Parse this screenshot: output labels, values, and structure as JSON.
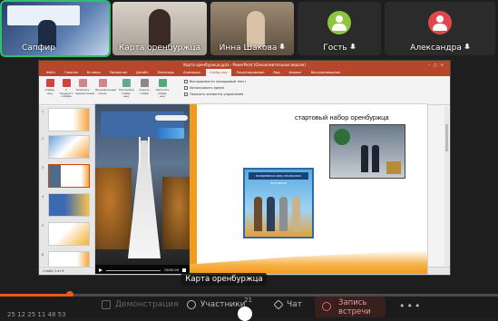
{
  "participants": [
    {
      "name": "Сапфир",
      "active": true
    },
    {
      "name": "Карта оренбуржца",
      "active": false
    },
    {
      "name": "Инна Шакова",
      "active": false
    },
    {
      "name": "Гость",
      "active": false
    },
    {
      "name": "Александра",
      "active": false
    }
  ],
  "colors": {
    "active_border": "#2fbf71",
    "guest_avatar": "#8cc63f",
    "alex_avatar": "#e0474c",
    "brand_orange": "#e45b1a",
    "ppt_red": "#b7472a"
  },
  "presentation": {
    "window_title": "Карта оренбуржца.pptx - PowerPoint (Ознакомительная версия)",
    "ribbon_tabs": [
      "Файл",
      "Главная",
      "Вставка",
      "Рисование",
      "Дизайн",
      "Переходы",
      "Анимация",
      "Слайд-шоу",
      "Рецензирование",
      "Вид",
      "Формат",
      "Воспроизведение"
    ],
    "ribbon_buttons": [
      "Слайд-шоу",
      "С текущего слайда",
      "Показать презентацию",
      "Произвольный показ",
      "Настройка слайд-шоу",
      "Скрыть слайд",
      "Записать слайд-шоу"
    ],
    "ribbon_options": [
      "Воспроизвести закадровый текст",
      "Использовать время",
      "Показать элементы управления"
    ],
    "slide_numbers": [
      "1",
      "2",
      "3",
      "4",
      "5",
      "6"
    ],
    "slide_heading": "стартовый набор оренбуржца",
    "box_caption": "ВОЛШЕБНАЯ СИЛА УРАЛЬСКИХ МАССИВОВ",
    "video_time": "00:00.00",
    "status_text": "Слайд 3 из 6"
  },
  "shared_screen_label": "Карта оренбуржца",
  "controls": {
    "time": "25 12 25 11 48 53",
    "progress": 0.14,
    "demo_label": "Демонстрация",
    "participants_label": "Участники",
    "participants_count": "21",
    "chat_label": "Чат",
    "record_label": "Запись встречи",
    "more_label": "•••"
  }
}
